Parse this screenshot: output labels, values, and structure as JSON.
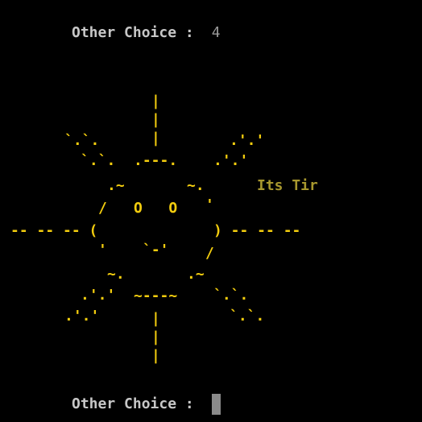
{
  "terminal": {
    "background": "#000000",
    "top_prompt": {
      "label": "Other Choice :",
      "value": "4"
    },
    "bottom_prompt": {
      "label": "Other Choice :"
    },
    "caption": "Its Tir",
    "ascii_art": {
      "color": "#f2cc0e",
      "top_ray": "|",
      "bottom_ray": "|",
      "diag_top_left": "`.`.",
      "diag_top_right": ".'.'",
      "diag_bottom_left": ".'.'",
      "diag_bottom_right": "`.`.",
      "left_ray": "-- -- -- (",
      "right_ray": ") -- -- --",
      "head_top": ".---.",
      "brow_left": ".~",
      "brow_right": "~.",
      "cheek_left": "/",
      "cheek_right": "'",
      "eyes": "O   O",
      "mouth": "`-'",
      "chin_left": "'",
      "chin_right": "/",
      "jaw_left": "~.",
      "jaw_right": ".~",
      "base": "~---~"
    }
  }
}
